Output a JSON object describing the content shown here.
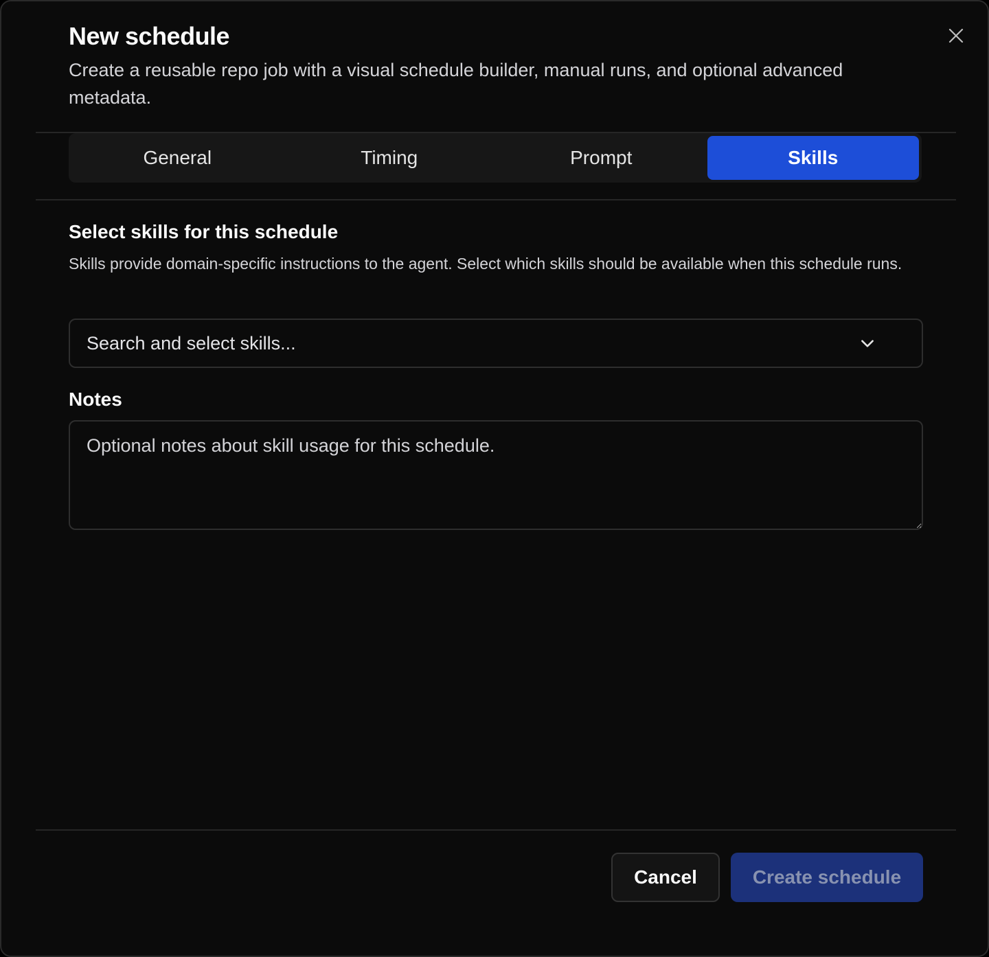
{
  "dialog": {
    "title": "New schedule",
    "subtitle": "Create a reusable repo job with a visual schedule builder, manual runs, and optional advanced metadata."
  },
  "tabs": [
    {
      "label": "General",
      "active": false
    },
    {
      "label": "Timing",
      "active": false
    },
    {
      "label": "Prompt",
      "active": false
    },
    {
      "label": "Skills",
      "active": true
    }
  ],
  "skills_section": {
    "title": "Select skills for this schedule",
    "description": "Skills provide domain-specific instructions to the agent. Select which skills should be available when this schedule runs.",
    "select_placeholder": "Search and select skills..."
  },
  "notes": {
    "label": "Notes",
    "placeholder": "Optional notes about skill usage for this schedule."
  },
  "footer": {
    "cancel_label": "Cancel",
    "create_label": "Create schedule"
  },
  "colors": {
    "accent": "#1d4ed8",
    "create_disabled": "#1c317a",
    "background": "#0b0b0b"
  },
  "icons": {
    "close": "close-icon",
    "dropdown": "chevron-down-icon"
  }
}
